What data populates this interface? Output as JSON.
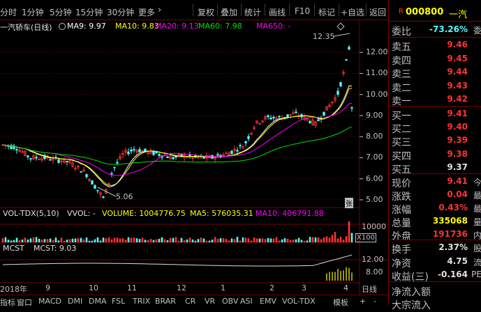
{
  "colors": {
    "up": "#ff3333",
    "down": "#54fcfc",
    "white": "#e0e0e0",
    "ma9": "#ffffff",
    "ma10": "#ffff00",
    "ma20": "#ff00ff",
    "ma60": "#00e000",
    "ma650": "#ff00ff",
    "grid": "#7a0000",
    "yellow": "#ffff00"
  },
  "topbar": {
    "periods": [
      "分时",
      "1分钟",
      "5分钟",
      "15分钟",
      "30分钟",
      "更多"
    ],
    "more_icon": "chevron-right-icon",
    "tools": [
      "复权",
      "叠加",
      "统计",
      "画线",
      "F10",
      "标记",
      "+自选",
      "返回"
    ]
  },
  "main_legend": {
    "title": "一汽轿车(日线)",
    "ma9": "MA9: 9.97",
    "ma10": "MA10: 9.83",
    "ma20": "MA20: 9.13",
    "ma60": "MA60: 7.98",
    "ma650": "MA650: -"
  },
  "vol_legend": {
    "title": "VOL-TDX(5,10)",
    "vwol": "VVOL: -",
    "volume": "VOLUME: 1004776.75",
    "ma5": "MA5: 576035.31",
    "ma10": "MA10: 406791.88"
  },
  "mcst_legend": {
    "title": "MCST",
    "value": "MCST: 9.03"
  },
  "annotations": {
    "high": "12.35",
    "low": "5.06",
    "zhang": "张",
    "x100": "X100"
  },
  "price_axis": [
    "12.00",
    "11.00",
    "10.00",
    "9.00",
    "8.00",
    "7.00",
    "6.00",
    "5.00"
  ],
  "vol_axis": [
    "10000"
  ],
  "mcst_axis": [
    "12.00",
    "8.00"
  ],
  "date_axis": [
    "2018年",
    "9",
    "10",
    "11",
    "12",
    "1",
    "2",
    "3",
    "4"
  ],
  "bottombar": {
    "tabs": [
      "指标",
      "窗口",
      "MACD",
      "DMI",
      "DMA",
      "FSL",
      "TRIX",
      "BRAR",
      "CR",
      "VR",
      "OBV",
      "ASI",
      "EMV",
      "VOL-TDX",
      "模板"
    ],
    "plus": "+",
    "minus": "-",
    "period": "日线"
  },
  "quote": {
    "badge": "R",
    "code": "000800",
    "name": "一汽",
    "weibi_label": "委比",
    "weibi_value": "-73.26%",
    "weibi_extra": "委",
    "asks": [
      {
        "label": "卖五",
        "price": "9.46"
      },
      {
        "label": "卖四",
        "price": "9.45"
      },
      {
        "label": "卖三",
        "price": "9.44"
      },
      {
        "label": "卖二",
        "price": "9.43"
      },
      {
        "label": "卖一",
        "price": "9.42"
      }
    ],
    "bids": [
      {
        "label": "买一",
        "price": "9.41"
      },
      {
        "label": "买二",
        "price": "9.40"
      },
      {
        "label": "买三",
        "price": "9.39"
      },
      {
        "label": "买四",
        "price": "9.38"
      },
      {
        "label": "买五",
        "price": "9.37"
      }
    ],
    "stats1": [
      {
        "label": "现价",
        "value": "9.41",
        "extra": "今"
      },
      {
        "label": "涨跌",
        "value": "0.04",
        "extra": "最"
      },
      {
        "label": "涨幅",
        "value": "0.43%",
        "extra": "最"
      },
      {
        "label": "总量",
        "value": "335068",
        "extra": "量"
      },
      {
        "label": "外盘",
        "value": "191736",
        "extra": "内"
      }
    ],
    "stats2": [
      {
        "label": "换手",
        "value": "2.37%",
        "extra": "股"
      },
      {
        "label": "净资",
        "value": "4.75",
        "extra": "流"
      },
      {
        "label": "收益(三)",
        "value": "-0.164",
        "extra": "PE"
      }
    ],
    "flow": [
      "净流入额",
      "大宗流入"
    ]
  },
  "chart_data": {
    "type": "candlestick",
    "series": [
      {
        "name": "MA9"
      },
      {
        "name": "MA10"
      },
      {
        "name": "MA20"
      },
      {
        "name": "MA60"
      }
    ],
    "ylim": [
      4.7,
      12.9
    ],
    "yticks": [
      5,
      6,
      7,
      8,
      9,
      10,
      11,
      12
    ],
    "xticks": [
      "2018年",
      "9",
      "10",
      "11",
      "12",
      "1",
      "2",
      "3",
      "4"
    ],
    "marked_high": 12.35,
    "marked_low": 5.06,
    "last_close": 9.41
  }
}
